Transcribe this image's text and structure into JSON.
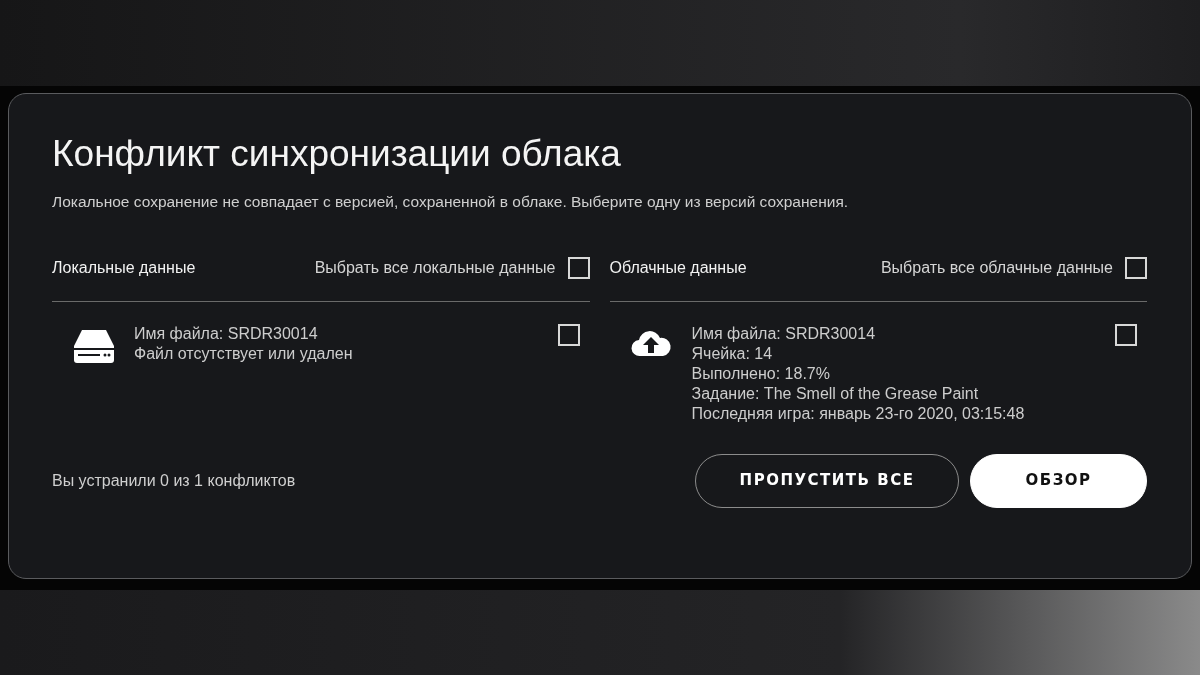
{
  "dialog": {
    "title": "Конфликт синхронизации облака",
    "description": "Локальное сохранение не совпадает с версией, сохраненной в облаке. Выберите одну из версий сохранения."
  },
  "columns": [
    {
      "kind": "local",
      "heading": "Локальные данные",
      "select_all_label": "Выбрать все локальные данные",
      "select_all_checked": false,
      "entry": {
        "lines": [
          "Имя файла: SRDR30014",
          "Файл отсутствует или удален"
        ],
        "checked": false
      }
    },
    {
      "kind": "cloud",
      "heading": "Облачные данные",
      "select_all_label": "Выбрать все облачные данные",
      "select_all_checked": false,
      "entry": {
        "lines": [
          "Имя файла: SRDR30014",
          "Ячейка: 14",
          "Выполнено: 18.7%",
          "Задание: The Smell of the Grease Paint",
          "Последняя игра: январь 23-го 2020, 03:15:48"
        ],
        "checked": false
      }
    }
  ],
  "status": "Вы устранили 0 из 1 конфликтов",
  "buttons": [
    {
      "kind": "outline",
      "label": "ПРОПУСТИТЬ ВСЕ"
    },
    {
      "kind": "solid",
      "label": "ОБЗОР"
    }
  ]
}
